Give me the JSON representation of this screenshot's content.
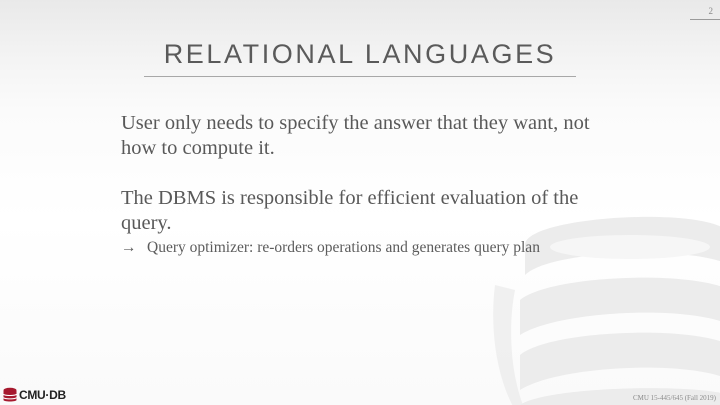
{
  "slide": {
    "page_number": "2",
    "title": "RELATIONAL LANGUAGES",
    "paragraphs": [
      "User only needs to specify the answer that they want, not how to compute it.",
      "The DBMS is responsible for efficient evaluation of the query."
    ],
    "sub_bullet": {
      "marker": "→",
      "text": "Query optimizer: re-orders operations and generates query plan"
    }
  },
  "footer": {
    "logo_text": "CMU·DB",
    "course_info": "CMU 15-445/645 (Fall 2019)"
  },
  "colors": {
    "logo_red": "#a6192e",
    "watermark_gray": "#ececec",
    "text_gray": "#595959"
  },
  "icons": {
    "logo": "database-cylinder-icon",
    "watermark": "database-watermark-icon"
  }
}
